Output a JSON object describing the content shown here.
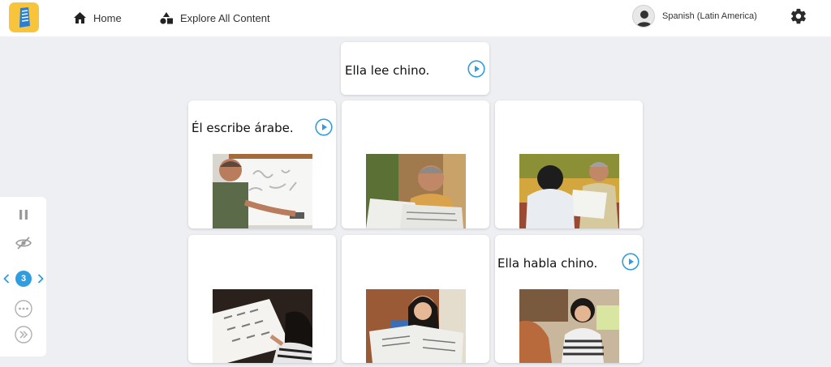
{
  "header": {
    "logo_icon": "rosetta-stone-logo-icon",
    "nav": {
      "home_label": "Home",
      "explore_label": "Explore All Content"
    },
    "language_label": "Spanish (Latin America)",
    "settings_icon": "gear-icon"
  },
  "side_controls": {
    "page_number": "3",
    "icons": [
      "pause-icon",
      "eye-off-icon",
      "chevron-left-icon",
      "chevron-right-icon",
      "more-icon",
      "skip-forward-icon"
    ]
  },
  "prompt": {
    "text": "Ella lee chino."
  },
  "cards": [
    {
      "caption": "Él escribe árabe.",
      "photo": "man writing Arabic on whiteboard"
    },
    {
      "caption": "",
      "photo": "man reading newspaper"
    },
    {
      "caption": "",
      "photo": "man reading newspaper to boy"
    },
    {
      "caption": "",
      "photo": "girl writing Chinese characters"
    },
    {
      "caption": "",
      "photo": "woman reading newspaper"
    },
    {
      "caption": "Ella habla chino.",
      "photo": "woman talking with friend"
    }
  ],
  "colors": {
    "accent_blue": "#2f9ddf",
    "logo_yellow": "#f7c43c",
    "background": "#eeeff2"
  }
}
